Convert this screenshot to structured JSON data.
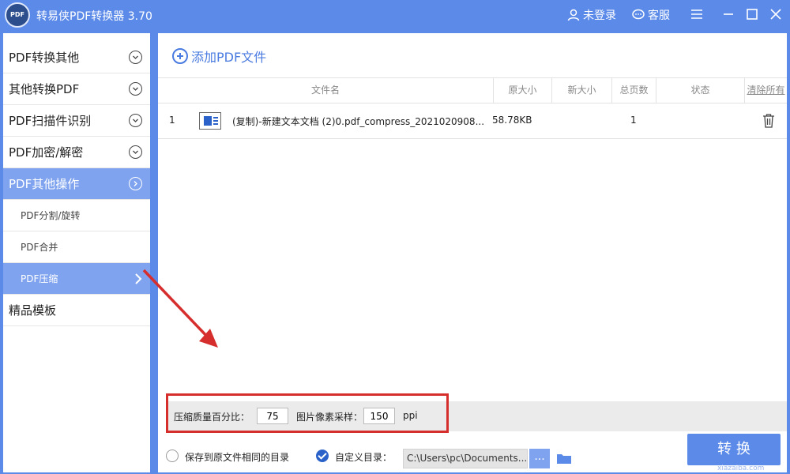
{
  "titlebar": {
    "logo_text": "PDF",
    "title": "转易侠PDF转换器 3.70",
    "login": "未登录",
    "service": "客服"
  },
  "sidebar": {
    "items": [
      {
        "label": "PDF转换其他"
      },
      {
        "label": "其他转换PDF"
      },
      {
        "label": "PDF扫描件识别"
      },
      {
        "label": "PDF加密/解密"
      },
      {
        "label": "PDF其他操作"
      }
    ],
    "sub_items": [
      {
        "label": "PDF分割/旋转"
      },
      {
        "label": "PDF合并"
      },
      {
        "label": "PDF压缩"
      }
    ],
    "templates": "精品模板"
  },
  "main": {
    "add_file": "添加PDF文件",
    "columns": {
      "filename": "文件名",
      "orig_size": "原大小",
      "new_size": "新大小",
      "pages": "总页数",
      "status": "状态",
      "clear": "清除所有"
    },
    "rows": [
      {
        "index": "1",
        "filename": "(复制)-新建文本文档 (2)0.pdf_compress_2021020908...",
        "orig_size": "58.78KB",
        "new_size": "",
        "pages": "1",
        "status": ""
      }
    ]
  },
  "settings": {
    "quality_label": "压缩质量百分比：",
    "quality_value": "75",
    "ppi_label": "图片像素采样：",
    "ppi_value": "150",
    "ppi_unit": "ppi"
  },
  "output": {
    "same_dir": "保存到原文件相同的目录",
    "custom_dir": "自定义目录：",
    "path": "C:\\Users\\pc\\Documents...",
    "browse": "..."
  },
  "convert_button": "转 换",
  "watermark": "xiazaiba.com",
  "colors": {
    "accent": "#5b8ae8",
    "active_item": "#7fa3ee",
    "highlight": "#d62d2d"
  }
}
